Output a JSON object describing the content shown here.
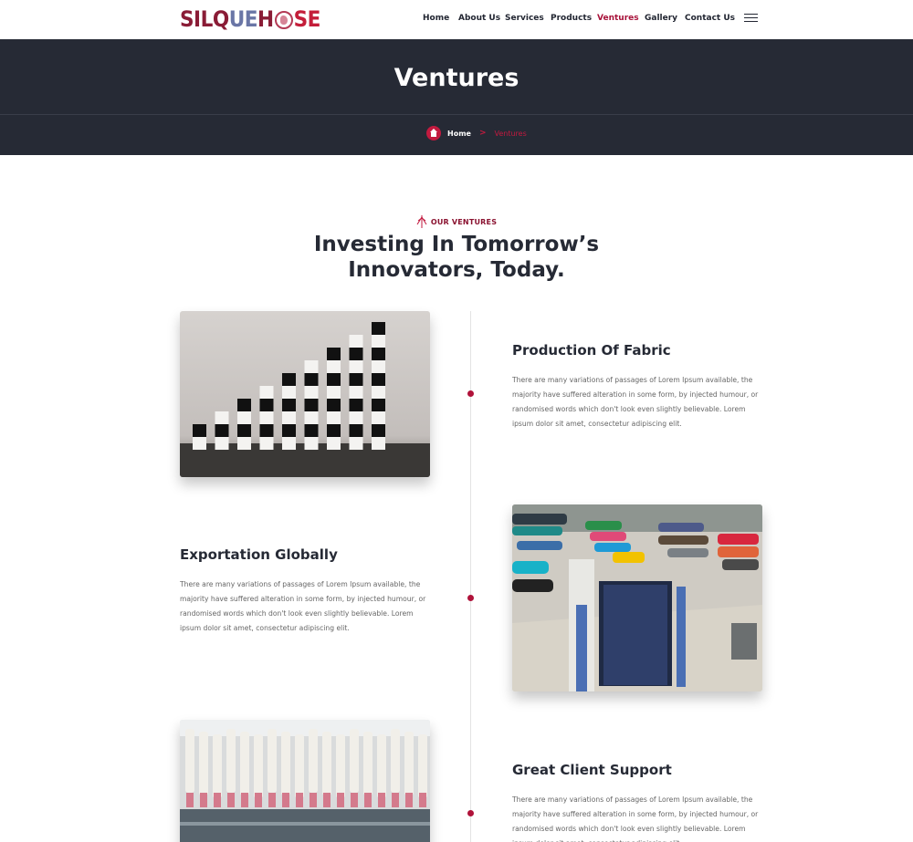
{
  "header": {
    "logo": "SILQUEHOSE",
    "nav": [
      {
        "label": "Home",
        "active": false
      },
      {
        "label": "About Us",
        "active": false
      },
      {
        "label": "Services",
        "active": false
      },
      {
        "label": "Products",
        "active": false
      },
      {
        "label": "Ventures",
        "active": true
      },
      {
        "label": "Gallery",
        "active": false
      },
      {
        "label": "Contact Us",
        "active": false
      }
    ],
    "menu_icon": "hamburger-icon"
  },
  "banner": {
    "title": "Ventures",
    "breadcrumb": {
      "home": "Home",
      "separator": ">",
      "current": "Ventures"
    }
  },
  "section": {
    "eyebrow": "OUR VENTURES",
    "title_line1": "Investing In Tomorrow’s",
    "title_line2": "Innovators, Today."
  },
  "ventures": [
    {
      "title": "Production Of Fabric",
      "text": "There are many variations of passages of Lorem Ipsum available, the majority have suffered alteration in some form, by injected humour, or randomised words which don't look even slightly believable. Lorem ipsum dolor sit amet, consectetur adipiscing elit.",
      "image": "stacked-blocks-growth-photo"
    },
    {
      "title": "Exportation Globally",
      "text": "There are many variations of passages of Lorem Ipsum available, the majority have suffered alteration in some form, by injected humour, or randomised words which don't look even slightly believable. Lorem ipsum dolor sit amet, consectetur adipiscing elit.",
      "image": "textile-factory-fabric-rolls-photo"
    },
    {
      "title": "Great Client Support",
      "text": "There are many variations of passages of Lorem Ipsum available, the majority have suffered alteration in some form, by injected humour, or randomised words which don't look even slightly believable. Lorem ipsum dolor sit amet, consectetur adipiscing elit.",
      "image": "spinning-mill-bobbins-photo"
    }
  ],
  "colors": {
    "accent": "#a8123a",
    "banner_bg": "#262a35",
    "heading": "#262a35",
    "body_text": "#666666"
  }
}
